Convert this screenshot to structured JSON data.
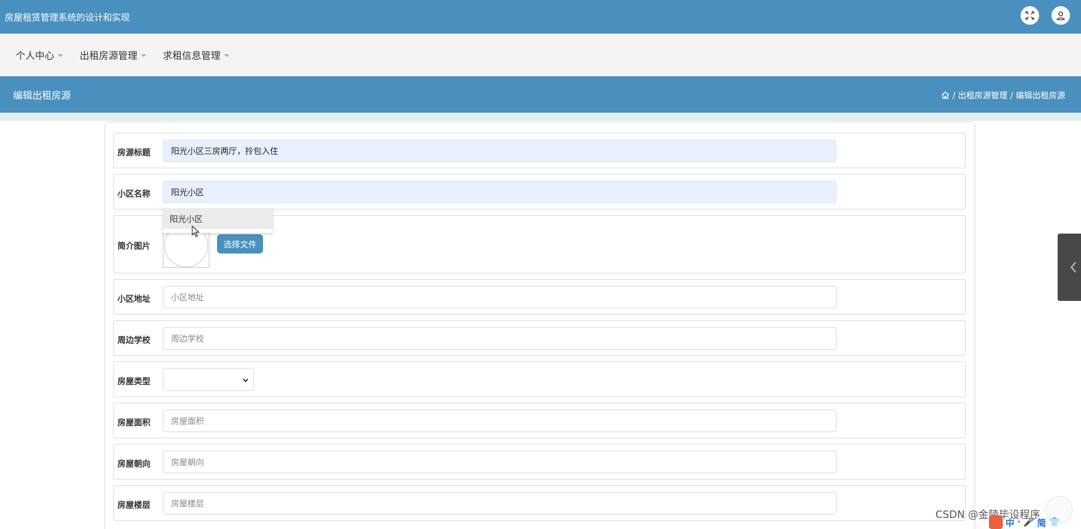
{
  "app": {
    "title": "房屋租赁管理系统的设计和实现"
  },
  "header_icons": [
    "fullscreen-icon",
    "user-icon"
  ],
  "nav": {
    "items": [
      {
        "label": "个人中心"
      },
      {
        "label": "出租房源管理"
      },
      {
        "label": "求租信息管理"
      }
    ]
  },
  "page": {
    "title": "编辑出租房源",
    "breadcrumb": [
      "出租房源管理",
      "编辑出租房源"
    ],
    "breadcrumb_separator": "/"
  },
  "form": {
    "title_field": {
      "label": "房源标题",
      "value": "阳光小区三房两厅，拎包入住"
    },
    "community_field": {
      "label": "小区名称",
      "value": "阳光小区"
    },
    "autocomplete": {
      "options": [
        "阳光小区"
      ]
    },
    "image_field": {
      "label": "简介图片",
      "button": "选择文件"
    },
    "address_field": {
      "label": "小区地址",
      "placeholder": "小区地址"
    },
    "school_field": {
      "label": "周边学校",
      "placeholder": "周边学校"
    },
    "type_field": {
      "label": "房屋类型",
      "selected": ""
    },
    "area_field": {
      "label": "房屋面积",
      "placeholder": "房屋面积"
    },
    "orientation_field": {
      "label": "房屋朝向",
      "placeholder": "房屋朝向"
    },
    "floor_field": {
      "label": "房屋楼层",
      "placeholder": "房屋楼层"
    }
  },
  "overlay": {
    "watermark": "CSDN @金陵毕设程序",
    "tray_text": [
      "中",
      "·",
      "简"
    ]
  },
  "colors": {
    "primary": "#4a90bf",
    "nav_bg": "#f5f3f6",
    "input_autofill": "#e8f0fe"
  }
}
